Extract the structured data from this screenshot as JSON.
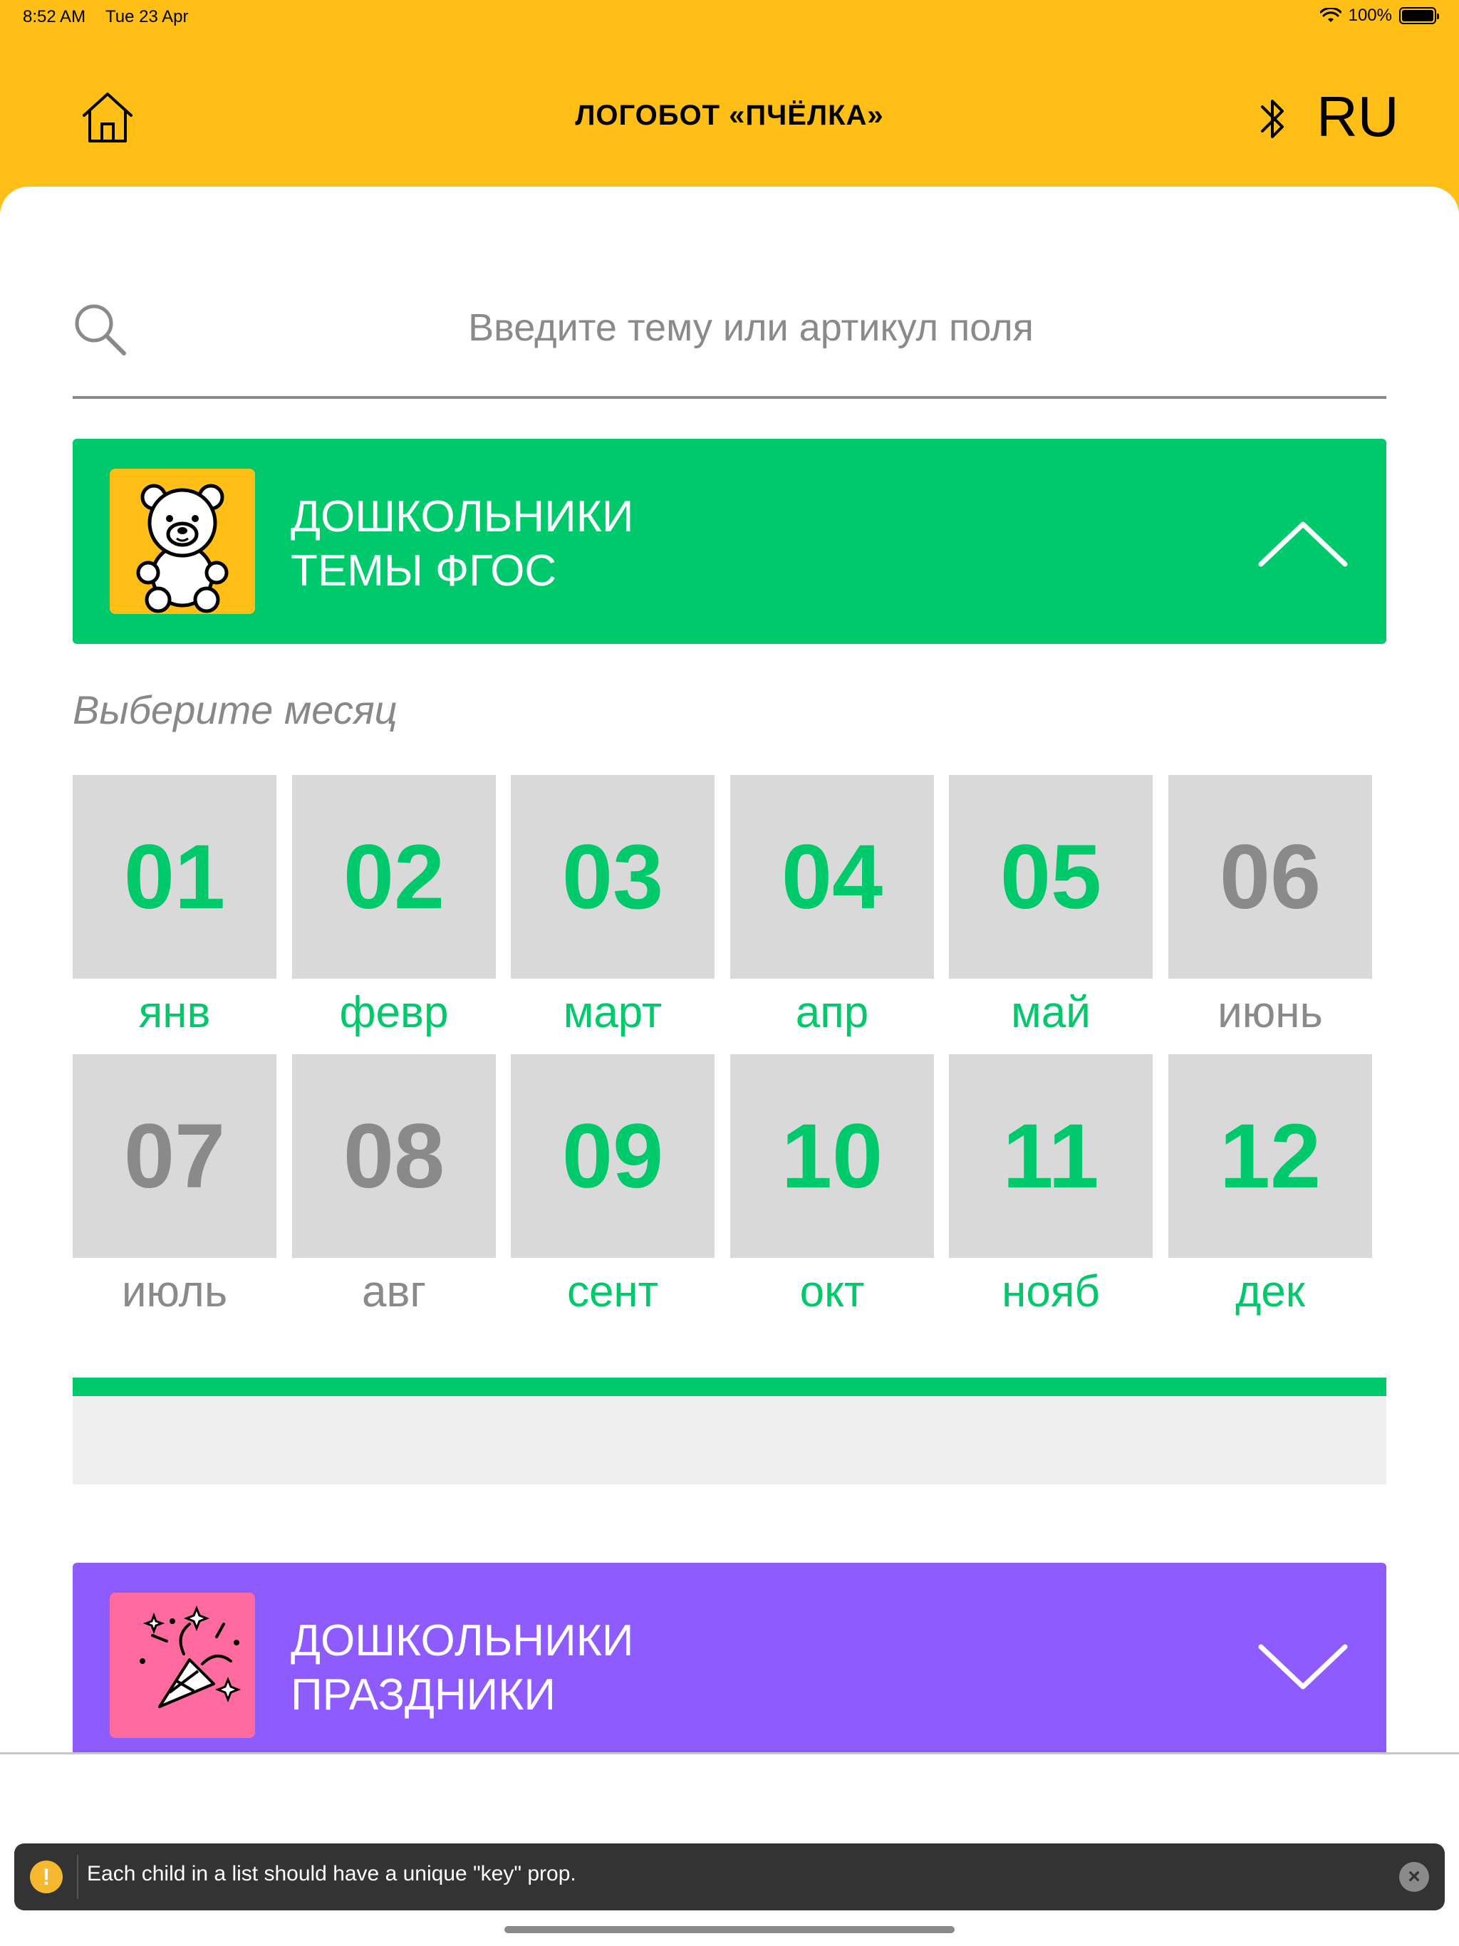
{
  "status_bar": {
    "time": "8:52 AM",
    "date": "Tue 23 Apr",
    "battery": "100%",
    "battery_level": 1.0,
    "icons": [
      "wifi-icon",
      "battery-icon"
    ]
  },
  "header": {
    "title": "ЛОГОБОТ «ПЧЁЛКА»",
    "language": "RU",
    "icons": [
      "home-icon",
      "bluetooth-icon"
    ]
  },
  "search": {
    "placeholder": "Введите тему или артикул поля",
    "value": ""
  },
  "categories": [
    {
      "line1": "ДОШКОЛЬНИКИ",
      "line2": "ТЕМЫ ФГОС",
      "color": "#00C96B",
      "icon": "teddy-bear-icon",
      "expanded": true
    },
    {
      "line1": "ДОШКОЛЬНИКИ",
      "line2": "ПРАЗДНИКИ",
      "color": "#8E5BFF",
      "icon": "party-popper-icon",
      "expanded": false
    }
  ],
  "month_prompt": "Выберите месяц",
  "months": [
    {
      "num": "01",
      "name": "янв",
      "active": true
    },
    {
      "num": "02",
      "name": "февр",
      "active": true
    },
    {
      "num": "03",
      "name": "март",
      "active": true
    },
    {
      "num": "04",
      "name": "апр",
      "active": true
    },
    {
      "num": "05",
      "name": "май",
      "active": true
    },
    {
      "num": "06",
      "name": "июнь",
      "active": false
    },
    {
      "num": "07",
      "name": "июль",
      "active": false
    },
    {
      "num": "08",
      "name": "авг",
      "active": false
    },
    {
      "num": "09",
      "name": "сент",
      "active": true
    },
    {
      "num": "10",
      "name": "окт",
      "active": true
    },
    {
      "num": "11",
      "name": "нояб",
      "active": true
    },
    {
      "num": "12",
      "name": "дек",
      "active": true
    }
  ],
  "progress": {
    "fraction": 1.0
  },
  "toast": {
    "message": "Each child in a list should have a unique \"key\" prop.",
    "icon": "warning-icon"
  },
  "colors": {
    "header": "#FFBF17",
    "accent_green": "#00C96B",
    "accent_purple": "#8E5BFF",
    "inactive_gray": "#8A8A8A"
  }
}
